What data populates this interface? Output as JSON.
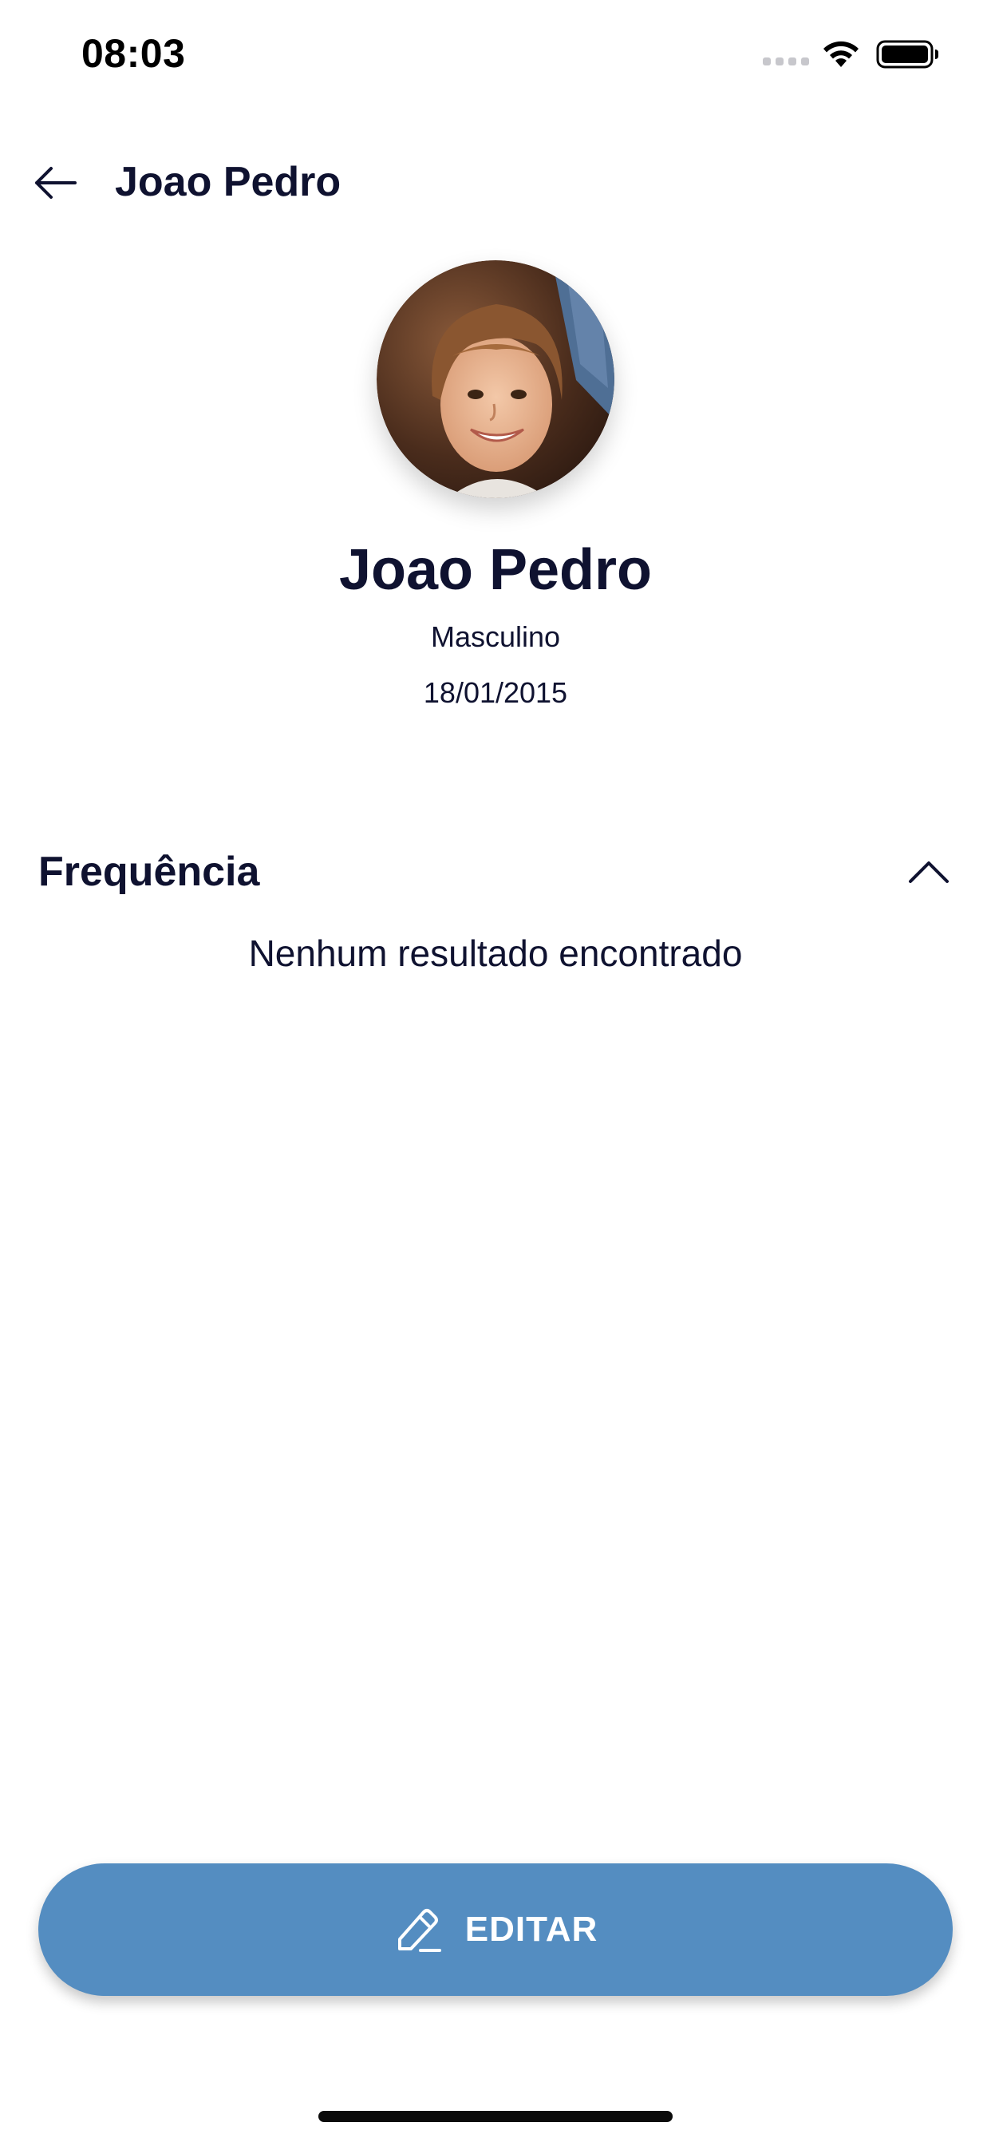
{
  "status_bar": {
    "time": "08:03"
  },
  "header": {
    "title": "Joao Pedro"
  },
  "profile": {
    "name": "Joao Pedro",
    "gender": "Masculino",
    "birthdate": "18/01/2015"
  },
  "frequency_section": {
    "title": "Frequência",
    "empty_message": "Nenhum resultado encontrado",
    "expanded": true
  },
  "edit_button": {
    "label": "EDITAR"
  },
  "icons": {
    "back": "arrow-left-icon",
    "collapse": "chevron-up-icon",
    "edit": "pencil-icon",
    "wifi": "wifi-icon",
    "battery": "battery-icon",
    "signal": "signal-icon"
  },
  "colors": {
    "primary_text": "#0f1230",
    "button_background": "#548dc1",
    "button_text": "#ffffff"
  }
}
